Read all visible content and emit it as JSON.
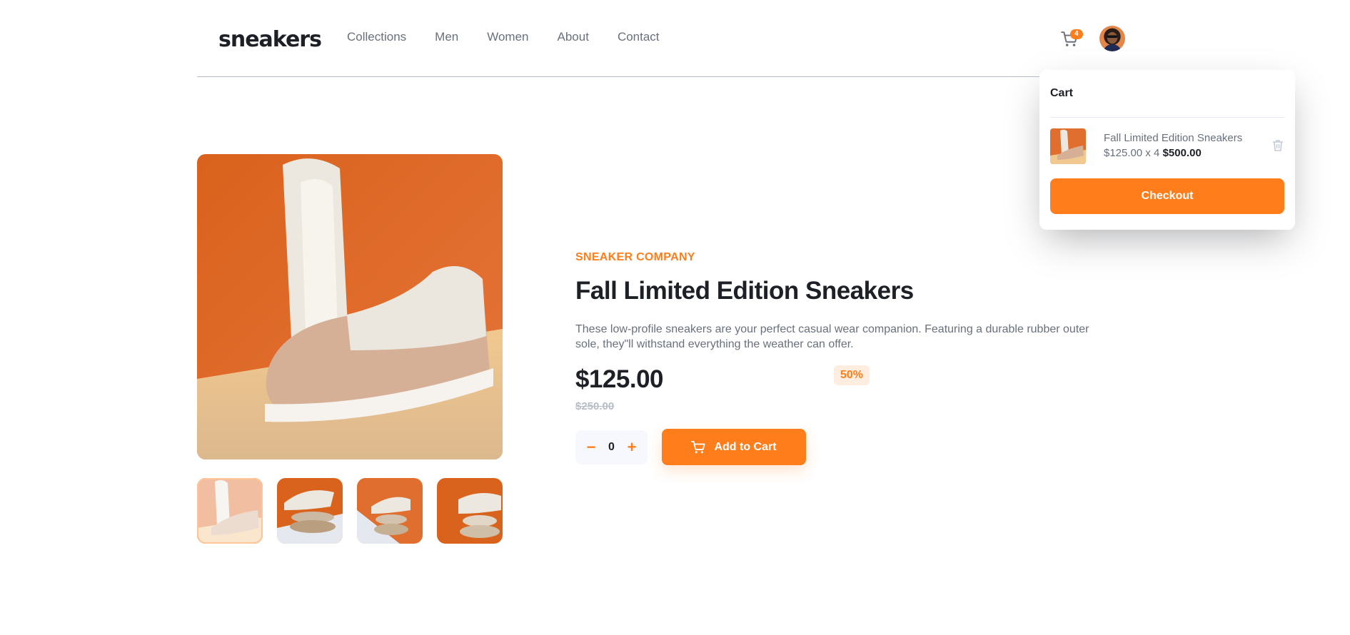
{
  "header": {
    "logo": "sneakers",
    "nav": [
      "Collections",
      "Men",
      "Women",
      "About",
      "Contact"
    ],
    "cart_count": "4",
    "cart_icon": "cart-icon",
    "avatar_icon": "avatar"
  },
  "product": {
    "company": "SNEAKER COMPANY",
    "title": "Fall Limited Edition Sneakers",
    "description": "These low-profile sneakers are your perfect casual wear companion. Featuring a durable rubber outer sole, they\"ll withstand everything the weather can offer.",
    "price": "$125.00",
    "discount": "50%",
    "old_price": "$250.00",
    "quantity": "0",
    "minus": "−",
    "plus": "+",
    "add_to_cart": "Add to Cart"
  },
  "cart": {
    "title": "Cart",
    "item_name": "Fall Limited Edition Sneakers",
    "item_unit": "$125.00 x 4",
    "item_total": "$500.00",
    "checkout": "Checkout"
  },
  "colors": {
    "accent": "#ff7e1b",
    "accent_pale": "#ffede0",
    "text_dark": "#1d2026",
    "text_muted": "#69707d"
  }
}
